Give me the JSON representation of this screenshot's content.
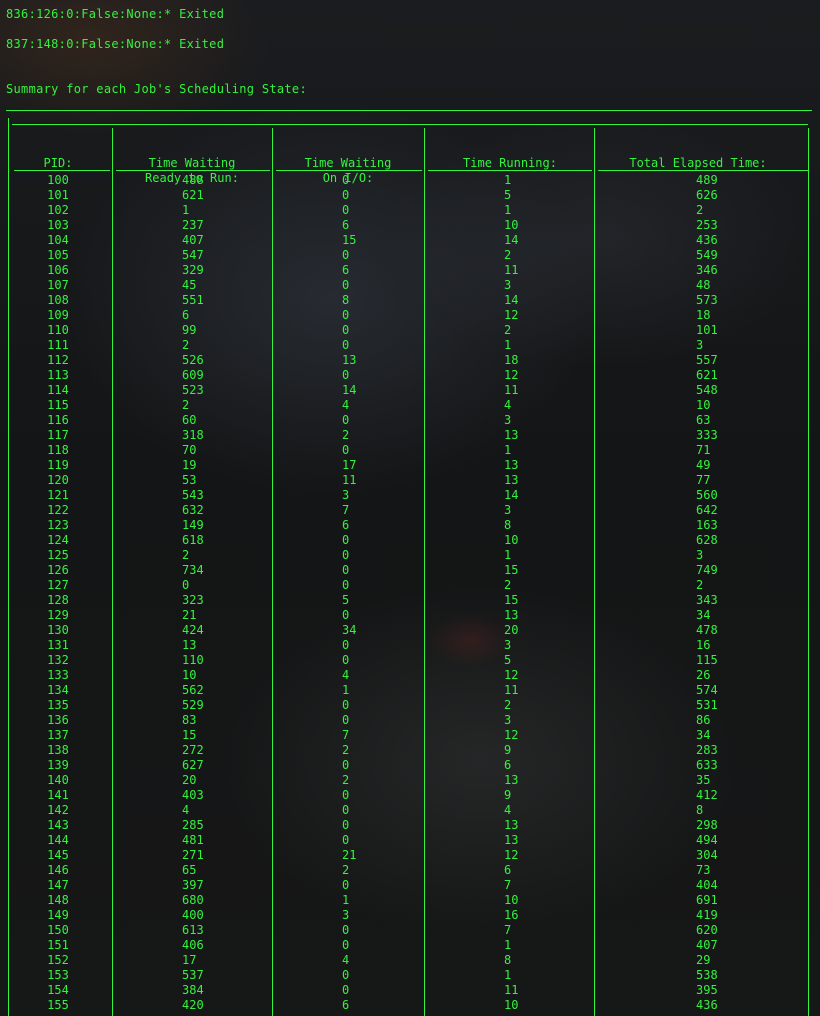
{
  "log_lines": [
    "836:126:0:False:None:* Exited",
    "837:148:0:False:None:* Exited"
  ],
  "summary_title": "Summary for each Job's Scheduling State:",
  "table": {
    "headers": [
      [
        "PID:",
        ""
      ],
      [
        "Time Waiting",
        "Ready to Run:"
      ],
      [
        "Time Waiting",
        "On I/O:"
      ],
      [
        "Time Running:",
        ""
      ],
      [
        "Total Elapsed Time:",
        ""
      ]
    ],
    "rows": [
      [
        "100",
        "488",
        "0",
        "1",
        "489"
      ],
      [
        "101",
        "621",
        "0",
        "5",
        "626"
      ],
      [
        "102",
        "1",
        "0",
        "1",
        "2"
      ],
      [
        "103",
        "237",
        "6",
        "10",
        "253"
      ],
      [
        "104",
        "407",
        "15",
        "14",
        "436"
      ],
      [
        "105",
        "547",
        "0",
        "2",
        "549"
      ],
      [
        "106",
        "329",
        "6",
        "11",
        "346"
      ],
      [
        "107",
        "45",
        "0",
        "3",
        "48"
      ],
      [
        "108",
        "551",
        "8",
        "14",
        "573"
      ],
      [
        "109",
        "6",
        "0",
        "12",
        "18"
      ],
      [
        "110",
        "99",
        "0",
        "2",
        "101"
      ],
      [
        "111",
        "2",
        "0",
        "1",
        "3"
      ],
      [
        "112",
        "526",
        "13",
        "18",
        "557"
      ],
      [
        "113",
        "609",
        "0",
        "12",
        "621"
      ],
      [
        "114",
        "523",
        "14",
        "11",
        "548"
      ],
      [
        "115",
        "2",
        "4",
        "4",
        "10"
      ],
      [
        "116",
        "60",
        "0",
        "3",
        "63"
      ],
      [
        "117",
        "318",
        "2",
        "13",
        "333"
      ],
      [
        "118",
        "70",
        "0",
        "1",
        "71"
      ],
      [
        "119",
        "19",
        "17",
        "13",
        "49"
      ],
      [
        "120",
        "53",
        "11",
        "13",
        "77"
      ],
      [
        "121",
        "543",
        "3",
        "14",
        "560"
      ],
      [
        "122",
        "632",
        "7",
        "3",
        "642"
      ],
      [
        "123",
        "149",
        "6",
        "8",
        "163"
      ],
      [
        "124",
        "618",
        "0",
        "10",
        "628"
      ],
      [
        "125",
        "2",
        "0",
        "1",
        "3"
      ],
      [
        "126",
        "734",
        "0",
        "15",
        "749"
      ],
      [
        "127",
        "0",
        "0",
        "2",
        "2"
      ],
      [
        "128",
        "323",
        "5",
        "15",
        "343"
      ],
      [
        "129",
        "21",
        "0",
        "13",
        "34"
      ],
      [
        "130",
        "424",
        "34",
        "20",
        "478"
      ],
      [
        "131",
        "13",
        "0",
        "3",
        "16"
      ],
      [
        "132",
        "110",
        "0",
        "5",
        "115"
      ],
      [
        "133",
        "10",
        "4",
        "12",
        "26"
      ],
      [
        "134",
        "562",
        "1",
        "11",
        "574"
      ],
      [
        "135",
        "529",
        "0",
        "2",
        "531"
      ],
      [
        "136",
        "83",
        "0",
        "3",
        "86"
      ],
      [
        "137",
        "15",
        "7",
        "12",
        "34"
      ],
      [
        "138",
        "272",
        "2",
        "9",
        "283"
      ],
      [
        "139",
        "627",
        "0",
        "6",
        "633"
      ],
      [
        "140",
        "20",
        "2",
        "13",
        "35"
      ],
      [
        "141",
        "403",
        "0",
        "9",
        "412"
      ],
      [
        "142",
        "4",
        "0",
        "4",
        "8"
      ],
      [
        "143",
        "285",
        "0",
        "13",
        "298"
      ],
      [
        "144",
        "481",
        "0",
        "13",
        "494"
      ],
      [
        "145",
        "271",
        "21",
        "12",
        "304"
      ],
      [
        "146",
        "65",
        "2",
        "6",
        "73"
      ],
      [
        "147",
        "397",
        "0",
        "7",
        "404"
      ],
      [
        "148",
        "680",
        "1",
        "10",
        "691"
      ],
      [
        "149",
        "400",
        "3",
        "16",
        "419"
      ],
      [
        "150",
        "613",
        "0",
        "7",
        "620"
      ],
      [
        "151",
        "406",
        "0",
        "1",
        "407"
      ],
      [
        "152",
        "17",
        "4",
        "8",
        "29"
      ],
      [
        "153",
        "537",
        "0",
        "1",
        "538"
      ],
      [
        "154",
        "384",
        "0",
        "11",
        "395"
      ],
      [
        "155",
        "420",
        "6",
        "10",
        "436"
      ]
    ]
  }
}
